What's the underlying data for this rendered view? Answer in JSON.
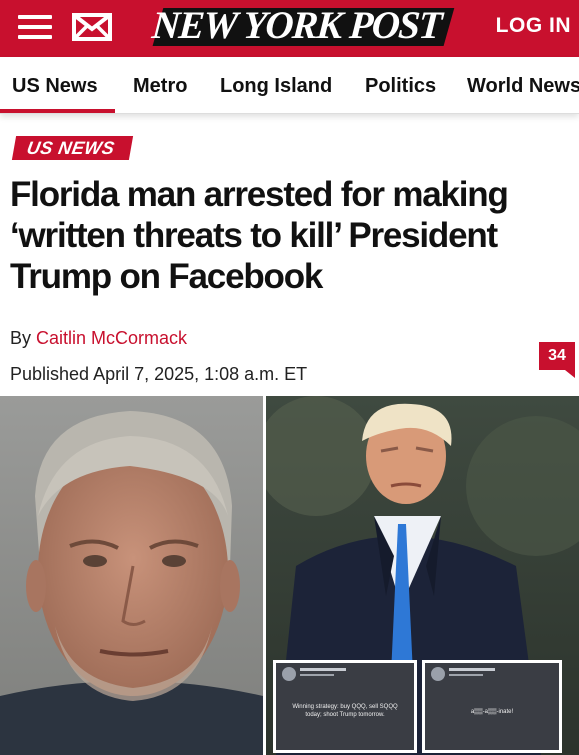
{
  "header": {
    "logo": "NEW YORK POST",
    "login_label": "LOG IN",
    "menu_icon": "hamburger-icon",
    "mail_icon": "mail-icon",
    "brand_color": "#c8102e"
  },
  "nav": {
    "items": [
      "US News",
      "Metro",
      "Long Island",
      "Politics",
      "World News"
    ],
    "active": "US News"
  },
  "article": {
    "section": "US NEWS",
    "headline": "Florida man arrested for making ‘written threats to kill’ President Trump on Facebook",
    "byline_prefix": "By",
    "author": "Caitlin McCormack",
    "published": "Published April 7, 2025, 1:08 a.m. ET",
    "comment_count": "34"
  },
  "images": {
    "left_alt": "Mugshot of the arrested man",
    "right_alt": "President Trump in a dark coat and blue tie",
    "insets": [
      {
        "text": "Winning strategy: buy QQQ, sell SQQQ today; shoot Trump tomorrow."
      },
      {
        "text": "a▒▒-a▒▒-inate!"
      }
    ]
  }
}
